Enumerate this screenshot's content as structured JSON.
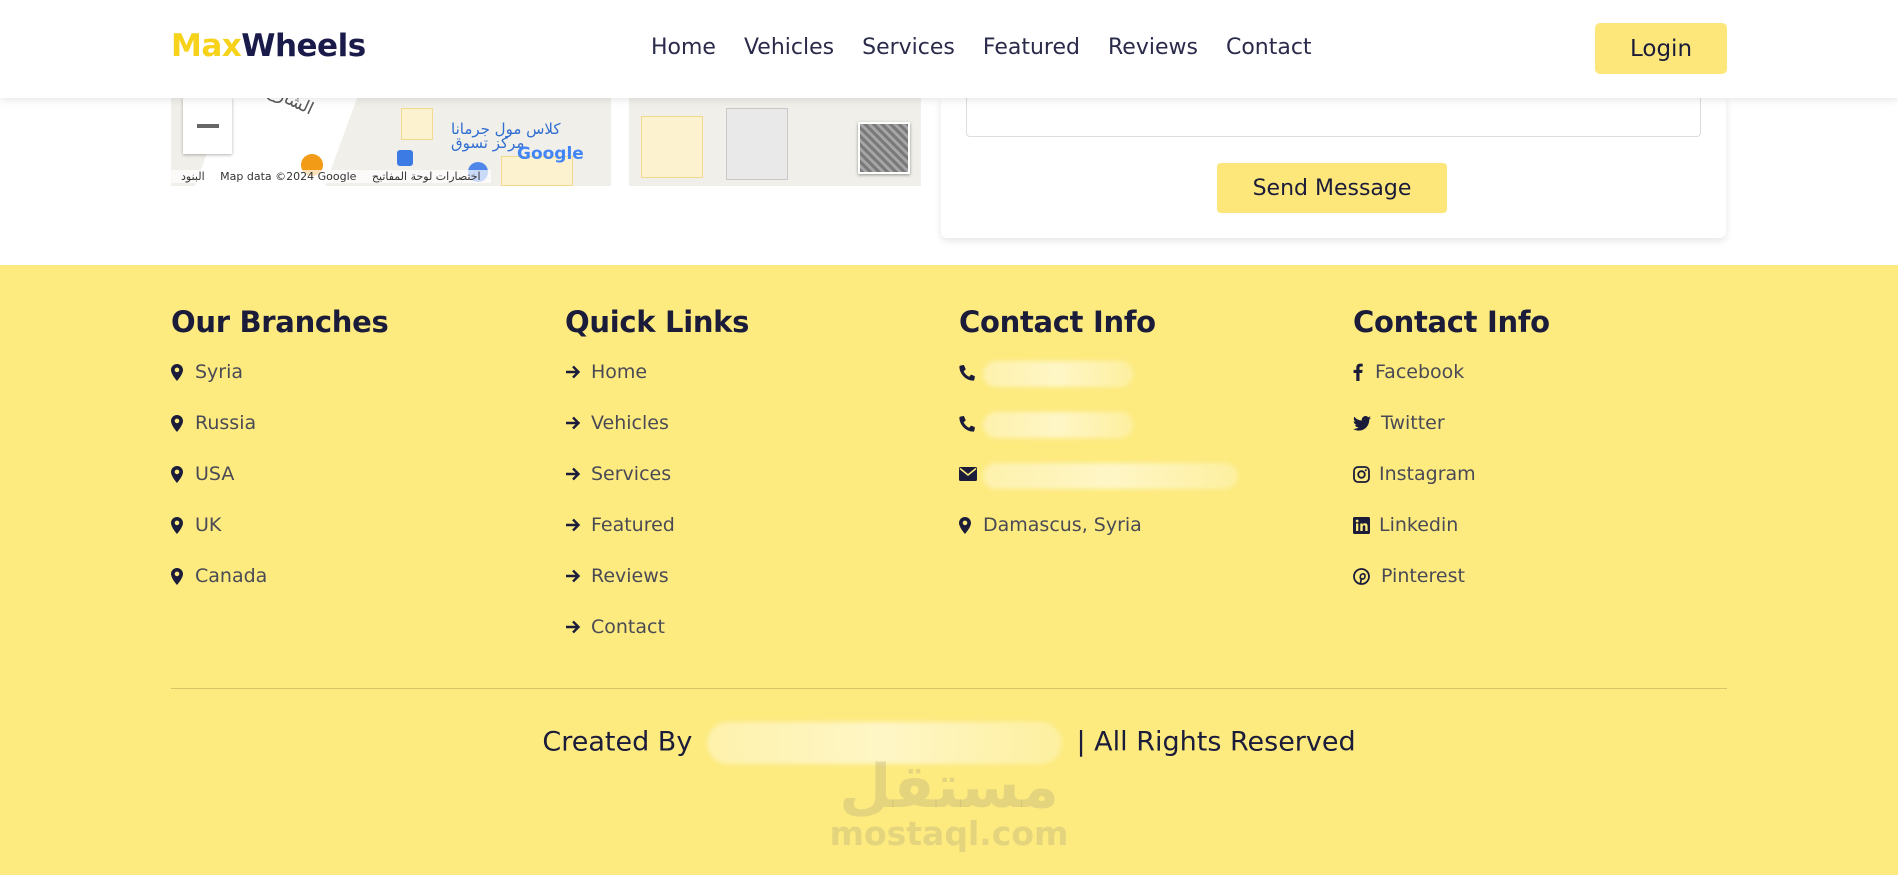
{
  "header": {
    "logo_part1": "Max",
    "logo_part2": "Wheels",
    "nav": [
      "Home",
      "Vehicles",
      "Services",
      "Featured",
      "Reviews",
      "Contact"
    ],
    "login_label": "Login"
  },
  "map": {
    "street_label": "الشارع",
    "poi_label_line1": "كلاس مول جرمانا",
    "poi_label_line2": "مركز تسوق",
    "google_label": "Google",
    "attribution_terms": "البنود",
    "attribution_data": "Map data ©2024 Google",
    "attribution_shortcuts": "اختصارات لوحة المفاتيح"
  },
  "contact_form": {
    "send_label": "Send Message"
  },
  "footer": {
    "branches": {
      "title": "Our Branches",
      "items": [
        "Syria",
        "Russia",
        "USA",
        "UK",
        "Canada"
      ]
    },
    "quick_links": {
      "title": "Quick Links",
      "items": [
        "Home",
        "Vehicles",
        "Services",
        "Featured",
        "Reviews",
        "Contact"
      ]
    },
    "contact_info": {
      "title": "Contact Info",
      "address": "Damascus, Syria"
    },
    "social": {
      "title": "Contact Info",
      "items": [
        "Facebook",
        "Twitter",
        "Instagram",
        "Linkedin",
        "Pinterest"
      ]
    },
    "copyright_prefix": "Created By",
    "copyright_suffix": "| All Rights Reserved"
  },
  "watermark": {
    "arabic": "مستقل",
    "latin": "mostaql.com"
  },
  "colors": {
    "accent_yellow": "#fde77a",
    "footer_bg": "#fdeb80",
    "logo_yellow": "#f7d21a",
    "dark_navy": "#1b1b3a"
  }
}
